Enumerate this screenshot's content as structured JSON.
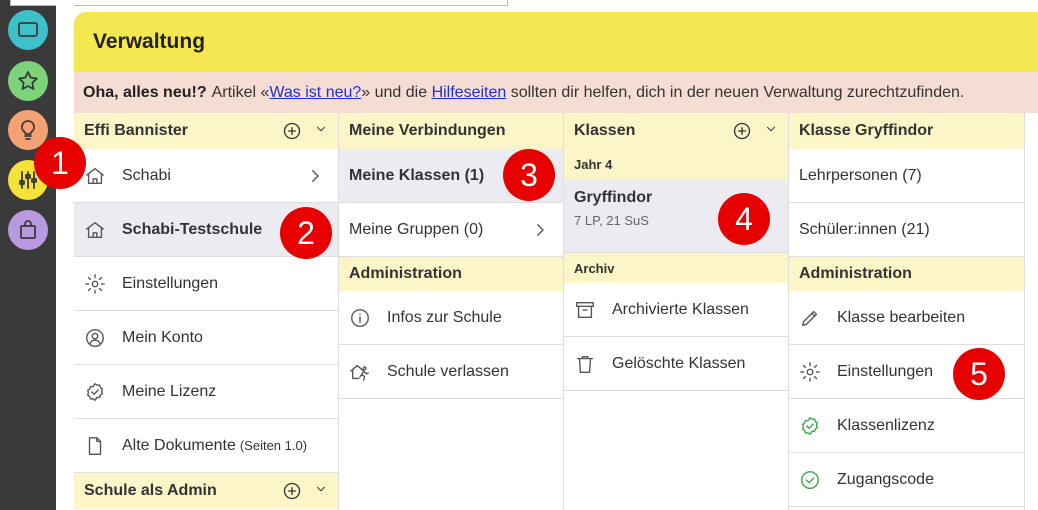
{
  "panel": {
    "title": "Verwaltung",
    "notice": {
      "bold": "Oha, alles neu!?",
      "text1": "Artikel «",
      "link1": "Was ist neu?",
      "text2": "» und die ",
      "link2": "Hilfeseiten",
      "text3": " sollten dir helfen, dich in der neuen Verwaltung zurechtzufinden."
    }
  },
  "rail": {
    "buttons": [
      {
        "icon": "screen-icon",
        "color": "#3fc1c9"
      },
      {
        "icon": "star-icon",
        "color": "#7dd37a"
      },
      {
        "icon": "lightbulb-icon",
        "color": "#f4a174"
      },
      {
        "icon": "sliders-icon",
        "color": "#f5e33a"
      },
      {
        "icon": "bag-icon",
        "color": "#b99ae0"
      }
    ]
  },
  "col1": {
    "header": "Effi Bannister",
    "items": [
      {
        "label": "Schabi",
        "icon": "house-icon"
      },
      {
        "label": "Schabi-Testschule",
        "icon": "house-icon"
      },
      {
        "label": "Einstellungen",
        "icon": "gear-icon"
      },
      {
        "label": "Mein Konto",
        "icon": "user-circle-icon"
      },
      {
        "label": "Meine Lizenz",
        "icon": "license-badge-icon"
      },
      {
        "label": "Alte Dokumente",
        "suffix": "(Seiten 1.0)",
        "icon": "document-icon"
      }
    ],
    "footer": "Schule als Admin"
  },
  "col2": {
    "header": "Meine Verbindungen",
    "items": [
      {
        "label": "Meine Klassen (1)"
      },
      {
        "label": "Meine Gruppen (0)"
      }
    ],
    "admin_header": "Administration",
    "admin_items": [
      {
        "label": "Infos zur Schule",
        "icon": "info-icon"
      },
      {
        "label": "Schule verlassen",
        "icon": "leave-school-icon"
      }
    ]
  },
  "col3": {
    "header": "Klassen",
    "year_header": "Jahr 4",
    "klasse": {
      "name": "Gryffindor",
      "meta": "7 LP, 21 SuS"
    },
    "archive_header": "Archiv",
    "items": [
      {
        "label": "Archivierte Klassen",
        "icon": "archive-icon"
      },
      {
        "label": "Gelöschte Klassen",
        "icon": "trash-icon"
      }
    ]
  },
  "col4": {
    "header": "Klasse Gryffindor",
    "items": [
      {
        "label": "Lehrpersonen (7)"
      },
      {
        "label": "Schüler:innen (21)"
      }
    ],
    "admin_header": "Administration",
    "admin_items": [
      {
        "label": "Klasse bearbeiten",
        "icon": "pencil-icon"
      },
      {
        "label": "Einstellungen",
        "icon": "gear-icon"
      },
      {
        "label": "Klassenlizenz",
        "icon": "license-badge-icon"
      },
      {
        "label": "Zugangscode",
        "icon": "check-circle-icon"
      }
    ]
  },
  "badges": [
    "1",
    "2",
    "3",
    "4",
    "5"
  ],
  "colors": {
    "header_yellow": "#f5e750",
    "notice_pink": "#f5ddd3",
    "subhead": "#fbf5c8",
    "selected": "#ecebf1",
    "badge_red": "#e60000",
    "link": "#1f2fd9",
    "check_green": "#3aa64a"
  }
}
